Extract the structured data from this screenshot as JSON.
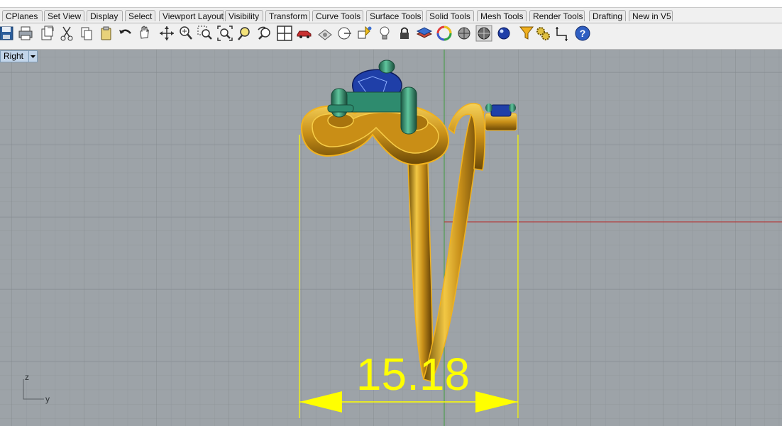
{
  "tabs": [
    {
      "label": "CPlanes"
    },
    {
      "label": "Set View"
    },
    {
      "label": "Display"
    },
    {
      "label": "Select"
    },
    {
      "label": "Viewport Layout"
    },
    {
      "label": "Visibility"
    },
    {
      "label": "Transform"
    },
    {
      "label": "Curve Tools"
    },
    {
      "label": "Surface Tools"
    },
    {
      "label": "Solid Tools"
    },
    {
      "label": "Mesh Tools"
    },
    {
      "label": "Render Tools"
    },
    {
      "label": "Drafting"
    },
    {
      "label": "New in V5"
    }
  ],
  "toolbar": [
    {
      "icon": "save-icon"
    },
    {
      "icon": "print-icon"
    },
    {
      "icon": "export-icon"
    },
    {
      "icon": "cut-icon"
    },
    {
      "icon": "copy-icon"
    },
    {
      "icon": "paste-icon"
    },
    {
      "icon": "undo-icon"
    },
    {
      "icon": "pan-hand-icon"
    },
    {
      "icon": "rotate-view-icon"
    },
    {
      "icon": "zoom-icon"
    },
    {
      "icon": "zoom-window-icon"
    },
    {
      "icon": "zoom-extents-icon"
    },
    {
      "icon": "zoom-selected-icon"
    },
    {
      "icon": "undo-view-icon"
    },
    {
      "icon": "four-viewports-icon"
    },
    {
      "icon": "car-icon"
    },
    {
      "icon": "named-view-icon"
    },
    {
      "icon": "cplane-icon"
    },
    {
      "icon": "snapshot-icon"
    },
    {
      "icon": "light-bulb-icon"
    },
    {
      "icon": "lock-icon"
    },
    {
      "icon": "layer-icon"
    },
    {
      "icon": "color-wheel-icon"
    },
    {
      "icon": "shaded-sphere-icon"
    },
    {
      "icon": "rendered-sphere-icon"
    },
    {
      "icon": "render-blue-sphere-icon"
    },
    {
      "icon": "funnel-icon"
    },
    {
      "icon": "options-gear-icon"
    },
    {
      "icon": "dimension-icon"
    },
    {
      "icon": "help-icon"
    }
  ],
  "viewport": {
    "name": "Right",
    "dimension_value": "15.18",
    "axis_z": "z",
    "axis_y": "y"
  },
  "colors": {
    "viewport_bg": "#9da3a8",
    "grid": "#8f959a",
    "axis_x": "#b34040",
    "axis_y": "#3e9a3e",
    "gold": "#d6a21a",
    "dimension": "#ffff00",
    "prong": "#2e8b6e",
    "stone": "#1f3fa8"
  }
}
